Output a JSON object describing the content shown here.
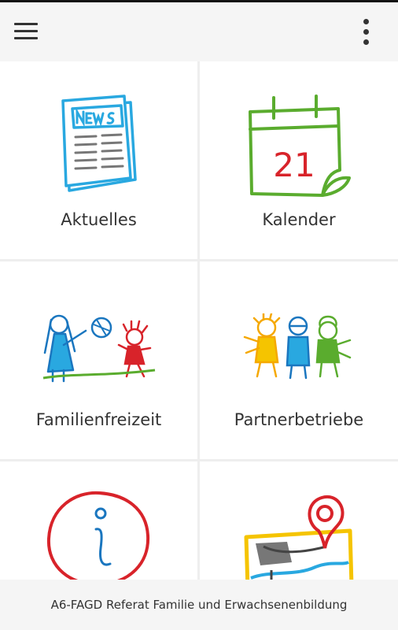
{
  "appbar": {
    "menu_icon": "hamburger-menu-icon",
    "overflow_icon": "more-vert-icon"
  },
  "tiles": [
    {
      "label": "Aktuelles",
      "icon": "newspaper-icon"
    },
    {
      "label": "Kalender",
      "icon": "calendar-icon",
      "calendar_day": "21"
    },
    {
      "label": "Familienfreizeit",
      "icon": "children-playing-icon"
    },
    {
      "label": "Partnerbetriebe",
      "icon": "partner-children-icon"
    },
    {
      "label": "",
      "icon": "info-icon"
    },
    {
      "label": "",
      "icon": "map-pin-icon"
    }
  ],
  "footer": {
    "text": "A6-FAGD Referat Familie und Erwachsenenbildung"
  },
  "colors": {
    "appbar_bg": "#f5f5f5",
    "tile_bg": "#ffffff",
    "grid_gap": "#eeeeee",
    "news_blue": "#29a8e0",
    "calendar_green": "#5aac2e",
    "calendar_red": "#d8232a",
    "info_red": "#d8232a",
    "map_yellow": "#f5c400"
  }
}
